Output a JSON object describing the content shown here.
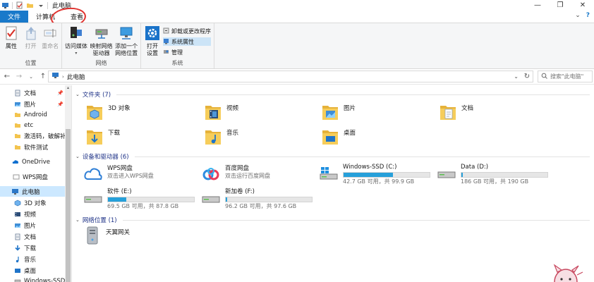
{
  "window": {
    "title": "此电脑",
    "minimize_glyph": "—",
    "maximize_glyph": "❐",
    "close_glyph": "✕"
  },
  "tabs": [
    {
      "label": "文件"
    },
    {
      "label": "计算机"
    },
    {
      "label": "查看"
    }
  ],
  "ribbon": {
    "location_group": {
      "label": "位置",
      "buttons": [
        {
          "label": "属性",
          "enabled": true
        },
        {
          "label": "打开",
          "enabled": false
        },
        {
          "label": "重命名",
          "enabled": false
        }
      ]
    },
    "network_group": {
      "label": "网络",
      "buttons": [
        {
          "label": "访问媒体"
        },
        {
          "label": "映射网络\n驱动器"
        },
        {
          "label": "添加一个\n网络位置"
        }
      ]
    },
    "system_group": {
      "label": "系统",
      "open_settings": "打开\n设置",
      "small_buttons": [
        {
          "label": "卸载或更改程序"
        },
        {
          "label": "系统属性"
        },
        {
          "label": "管理"
        }
      ]
    }
  },
  "address": {
    "path": "此电脑",
    "search_placeholder": "搜索\"此电脑\""
  },
  "sidebar": {
    "items": [
      {
        "label": "文档",
        "icon": "document-icon",
        "pinned": true
      },
      {
        "label": "图片",
        "icon": "pictures-icon",
        "pinned": true
      },
      {
        "label": "Android",
        "icon": "folder-icon",
        "pinned": false
      },
      {
        "label": "etc",
        "icon": "folder-icon",
        "pinned": false
      },
      {
        "label": "激活码，破解补丁",
        "icon": "folder-icon",
        "pinned": false
      },
      {
        "label": "软件测试",
        "icon": "folder-icon",
        "pinned": false
      },
      {
        "label": "OneDrive",
        "icon": "cloud-icon",
        "pinned": false
      },
      {
        "label": "WPS网盘",
        "icon": "wps-drive-icon",
        "pinned": false
      },
      {
        "label": "此电脑",
        "icon": "computer-icon",
        "pinned": false,
        "selected": true
      },
      {
        "label": "3D 对象",
        "icon": "3d-objects-icon",
        "pinned": false
      },
      {
        "label": "视频",
        "icon": "video-icon",
        "pinned": false
      },
      {
        "label": "图片",
        "icon": "pictures-icon",
        "pinned": false
      },
      {
        "label": "文档",
        "icon": "document-icon",
        "pinned": false
      },
      {
        "label": "下载",
        "icon": "download-icon",
        "pinned": false
      },
      {
        "label": "音乐",
        "icon": "music-icon",
        "pinned": false
      },
      {
        "label": "桌面",
        "icon": "desktop-icon",
        "pinned": false
      },
      {
        "label": "Windows-SSD (",
        "icon": "drive-icon",
        "pinned": false
      }
    ]
  },
  "sections": {
    "folders": {
      "label": "文件夹 (7)"
    },
    "devices": {
      "label": "设备和驱动器 (6)"
    },
    "network": {
      "label": "网络位置 (1)"
    }
  },
  "folders": [
    {
      "label": "3D 对象"
    },
    {
      "label": "视频"
    },
    {
      "label": "图片"
    },
    {
      "label": "文档"
    },
    {
      "label": "下载"
    },
    {
      "label": "音乐"
    },
    {
      "label": "桌面"
    }
  ],
  "devices": [
    {
      "name": "WPS网盘",
      "sub": "双击进入WPS网盘"
    },
    {
      "name": "百度网盘",
      "sub": "双击运行百度网盘"
    },
    {
      "name": "Windows-SSD (C:)",
      "sub": "42.7 GB 可用，共 99.9 GB",
      "used_fraction": 0.57
    },
    {
      "name": "Data (D:)",
      "sub": "186 GB 可用，共 190 GB",
      "used_fraction": 0.02
    },
    {
      "name": "软件 (E:)",
      "sub": "69.5 GB 可用，共 87.8 GB",
      "used_fraction": 0.21
    },
    {
      "name": "新加卷 (F:)",
      "sub": "96.2 GB 可用，共 97.6 GB",
      "used_fraction": 0.015
    }
  ],
  "network": [
    {
      "label": "天翼网关"
    }
  ],
  "colors": {
    "accent": "#1979ca",
    "drive_fill": "#26a0da",
    "section_header": "#1e3287",
    "selection": "#cce8ff",
    "folder_yellow": "#f3c44e"
  }
}
